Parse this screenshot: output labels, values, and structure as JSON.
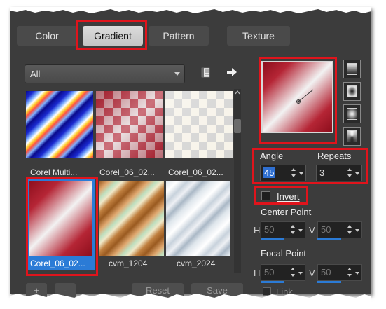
{
  "tabs": [
    {
      "label": "Color"
    },
    {
      "label": "Gradient"
    },
    {
      "label": "Pattern"
    },
    {
      "label": "Texture"
    }
  ],
  "category": {
    "selected": "All"
  },
  "gradients": [
    {
      "label": "Corel Multi..."
    },
    {
      "label": "Corel_06_02..."
    },
    {
      "label": "Corel_06_02..."
    },
    {
      "label": "Corel_06_02..."
    },
    {
      "label": "cvm_1204"
    },
    {
      "label": "cvm_2024"
    }
  ],
  "settings": {
    "angle_label": "Angle",
    "angle_value": "45",
    "repeats_label": "Repeats",
    "repeats_value": "3",
    "invert_label": "Invert",
    "center_point_label": "Center Point",
    "focal_point_label": "Focal Point",
    "h_label": "H",
    "v_label": "V",
    "center_h": "50",
    "center_v": "50",
    "focal_h": "50",
    "focal_v": "50",
    "link_label": "Link"
  },
  "bottom_buttons": {
    "add": "+",
    "remove": "-",
    "reset": "Reset",
    "save": "Save"
  },
  "colors": {
    "highlight": "#e0141c",
    "selection": "#2b7bd6",
    "panel": "#3c3c3c"
  }
}
